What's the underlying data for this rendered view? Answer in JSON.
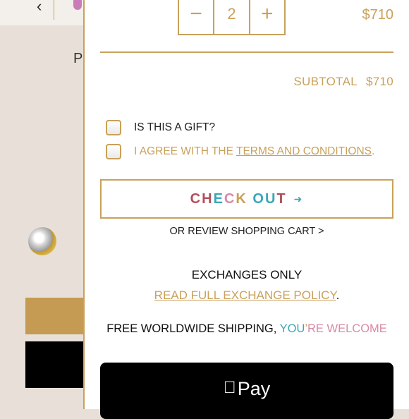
{
  "background": {
    "back_glyph": "‹",
    "letter": "P"
  },
  "cart": {
    "quantity": "2",
    "decrement_glyph": "−",
    "increment_glyph": "+",
    "item_price": "$710",
    "subtotal_label": "SUBTOTAL",
    "subtotal_value": "$710",
    "gift_label": "IS THIS A GIFT?",
    "terms_prefix": "I AGREE WITH THE ",
    "terms_link": "TERMS AND CONDITIONS",
    "terms_suffix": ".",
    "checkout_letters": [
      {
        "ch": "C",
        "color": "#b24f59"
      },
      {
        "ch": "H",
        "color": "#b24f59"
      },
      {
        "ch": "E",
        "color": "#3aa8b8"
      },
      {
        "ch": "C",
        "color": "#d98aa7"
      },
      {
        "ch": "K",
        "color": "#c9a15a"
      },
      {
        "ch": " ",
        "color": "#000000"
      },
      {
        "ch": "O",
        "color": "#3aa8b8"
      },
      {
        "ch": "U",
        "color": "#3aa8b8"
      },
      {
        "ch": "T",
        "color": "#b24f59"
      }
    ],
    "checkout_arrow": "➜",
    "review_link": "OR REVIEW SHOPPING CART >",
    "exchanges_title": "EXCHANGES ONLY",
    "policy_link": "READ FULL EXCHANGE POLICY",
    "policy_suffix": ".",
    "shipping_prefix": "FREE WORLDWIDE SHIPPING, ",
    "shipping_colored": [
      {
        "text": "YOU",
        "color": "#3aa8b8"
      },
      {
        "text": "’",
        "color": "#c9a15a"
      },
      {
        "text": "RE ",
        "color": "#d98aa7"
      },
      {
        "text": "WELCOME",
        "color": "#d98aa7"
      }
    ],
    "apple_pay_label": "Pay",
    "apple_glyph": ""
  },
  "colors": {
    "accent_gold": "#c9a15a",
    "text_dark": "#222222"
  }
}
